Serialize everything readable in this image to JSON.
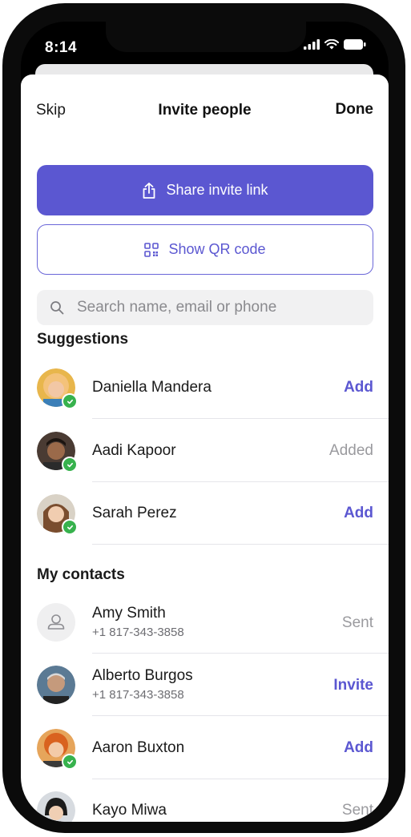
{
  "status_bar": {
    "time": "8:14"
  },
  "nav": {
    "skip": "Skip",
    "title": "Invite people",
    "done": "Done"
  },
  "share_button": {
    "label": "Share invite link"
  },
  "qr_button": {
    "label": "Show QR code"
  },
  "search": {
    "placeholder": "Search name, email or phone",
    "value": ""
  },
  "suggestions": {
    "title": "Suggestions",
    "items": [
      {
        "name": "Daniella Mandera",
        "action": "Add",
        "verified": true
      },
      {
        "name": "Aadi Kapoor",
        "action": "Added",
        "verified": true
      },
      {
        "name": "Sarah Perez",
        "action": "Add",
        "verified": true
      }
    ]
  },
  "contacts": {
    "title": "My contacts",
    "items": [
      {
        "name": "Amy Smith",
        "phone": "+1 817-343-3858",
        "action": "Sent",
        "avatar": "person-placeholder-icon"
      },
      {
        "name": "Alberto Burgos",
        "phone": "+1 817-343-3858",
        "action": "Invite"
      },
      {
        "name": "Aaron Buxton",
        "action": "Add",
        "verified": true
      },
      {
        "name": "Kayo Miwa",
        "action": "Sent"
      }
    ]
  },
  "colors": {
    "accent": "#5b57d1",
    "verified": "#37b24d",
    "muted": "#9a9a9e"
  }
}
